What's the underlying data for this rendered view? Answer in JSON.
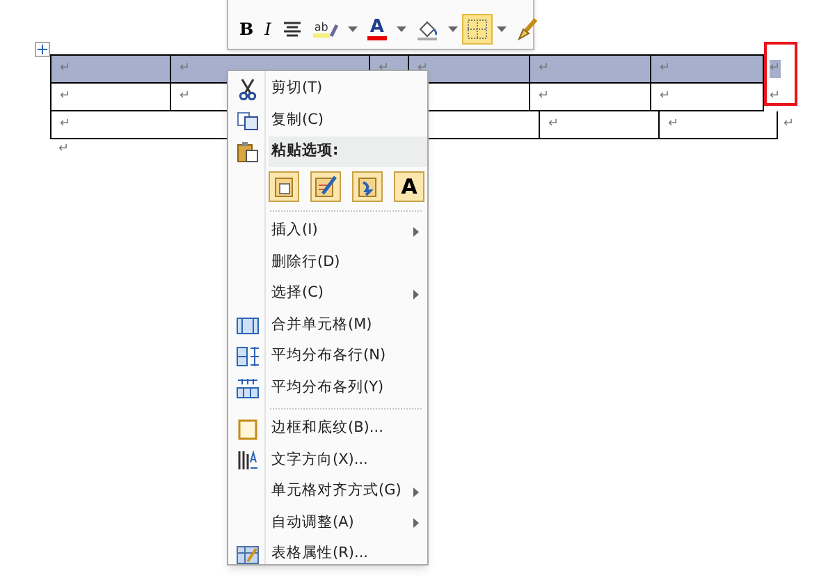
{
  "mini_toolbar": {
    "buttons": [
      {
        "kind": "bold",
        "label": "B",
        "dropdown": false,
        "selected": false
      },
      {
        "kind": "italic",
        "label": "I",
        "dropdown": false,
        "selected": false
      },
      {
        "kind": "align",
        "dropdown": false,
        "selected": false
      },
      {
        "kind": "highlight",
        "label": "ab",
        "dropdown": true,
        "selected": false
      },
      {
        "kind": "font_color",
        "label": "A",
        "dropdown": true,
        "selected": false
      },
      {
        "kind": "shading",
        "dropdown": true,
        "selected": false
      },
      {
        "kind": "borders",
        "dropdown": true,
        "selected": true
      },
      {
        "kind": "painter",
        "dropdown": false,
        "selected": false
      }
    ]
  },
  "table": {
    "rows": [
      {
        "selected": true,
        "cells": [
          "↵",
          "↵",
          "↵",
          "↵",
          "↵",
          "↵"
        ],
        "end_mark": "↵"
      },
      {
        "selected": false,
        "cells": [
          "↵",
          "↵",
          "",
          "",
          "↵",
          "↵"
        ],
        "end_mark": "↵"
      },
      {
        "selected": false,
        "cells": [
          "↵",
          "",
          "↵",
          "↵"
        ],
        "end_mark": "↵"
      }
    ],
    "highlight_frame": true
  },
  "paragraph_mark": "↵",
  "context_menu": {
    "items": [
      {
        "kind": "item",
        "label": "剪切(T)",
        "submenu": false
      },
      {
        "kind": "item",
        "label": "复制(C)",
        "submenu": false
      },
      {
        "kind": "header",
        "label": "粘贴选项:"
      },
      {
        "kind": "paste_options",
        "options": [
          {
            "kind": "keep"
          },
          {
            "kind": "merge"
          },
          {
            "kind": "text_only"
          },
          {
            "kind": "letter",
            "label": "A"
          }
        ]
      },
      {
        "kind": "separator"
      },
      {
        "kind": "item",
        "label": "插入(I)",
        "submenu": true
      },
      {
        "kind": "item",
        "label": "删除行(D)",
        "submenu": false
      },
      {
        "kind": "item",
        "label": "选择(C)",
        "submenu": true
      },
      {
        "kind": "item",
        "label": "合并单元格(M)",
        "submenu": false
      },
      {
        "kind": "item",
        "label": "平均分布各行(N)",
        "submenu": false
      },
      {
        "kind": "item",
        "label": "平均分布各列(Y)",
        "submenu": false
      },
      {
        "kind": "separator"
      },
      {
        "kind": "item",
        "label": "边框和底纹(B)...",
        "submenu": false
      },
      {
        "kind": "item",
        "label": "文字方向(X)...",
        "submenu": false
      },
      {
        "kind": "item",
        "label": "单元格对齐方式(G)",
        "submenu": true
      },
      {
        "kind": "item",
        "label": "自动调整(A)",
        "submenu": true
      },
      {
        "kind": "item",
        "label": "表格属性(R)...",
        "submenu": false
      }
    ]
  }
}
